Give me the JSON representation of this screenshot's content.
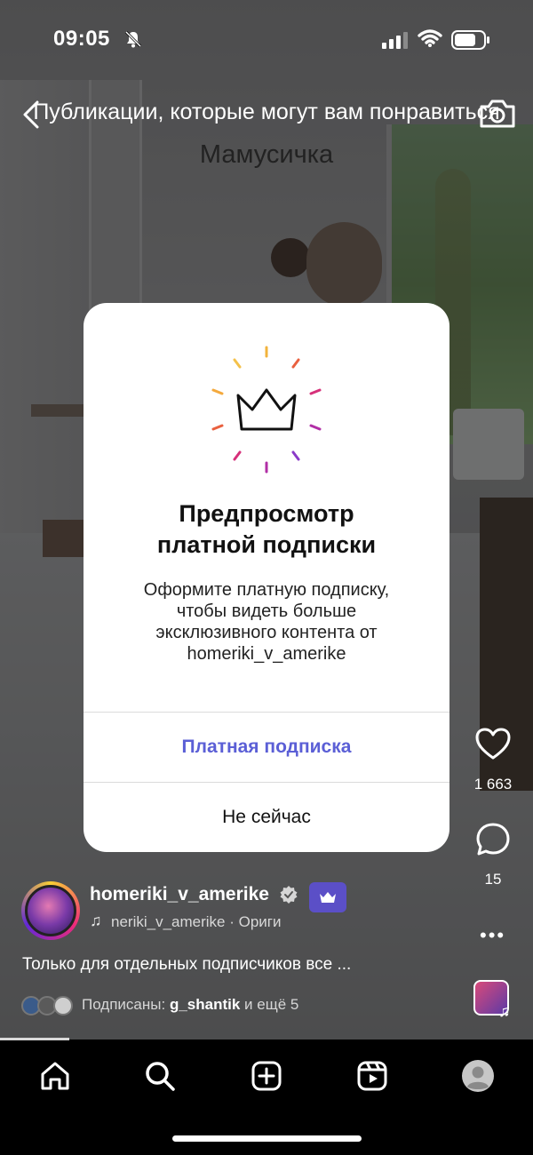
{
  "status_bar": {
    "time": "09:05"
  },
  "header": {
    "title": "Публикации, которые могут вам понравиться"
  },
  "video": {
    "caption": "Мамусичка"
  },
  "modal": {
    "title_line1": "Предпросмотр",
    "title_line2": "платной подписки",
    "body_line1": "Оформите платную подписку,",
    "body_line2": "чтобы видеть больше",
    "body_line3": "эксклюзивного контента от",
    "body_line4": "homeriki_v_amerike",
    "primary_label": "Платная подписка",
    "secondary_label": "Не сейчас",
    "accent_color": "#5b5fd6"
  },
  "actions": {
    "likes": "1 663",
    "comments": "15"
  },
  "author": {
    "username": "homeriki_v_amerike",
    "audio": "homeriki_v_amerike · Оригинальное аудио",
    "audio_visible": "neriki_v_amerike · Ориги"
  },
  "post": {
    "caption": "Только для отдельных подписчиков все ...",
    "followers_prefix": "Подписаны:",
    "followers_name": "g_shantik",
    "followers_suffix": "и ещё 5"
  },
  "nav": {
    "items": [
      "home-icon",
      "search-icon",
      "create-icon",
      "reels-icon",
      "profile-icon"
    ]
  }
}
